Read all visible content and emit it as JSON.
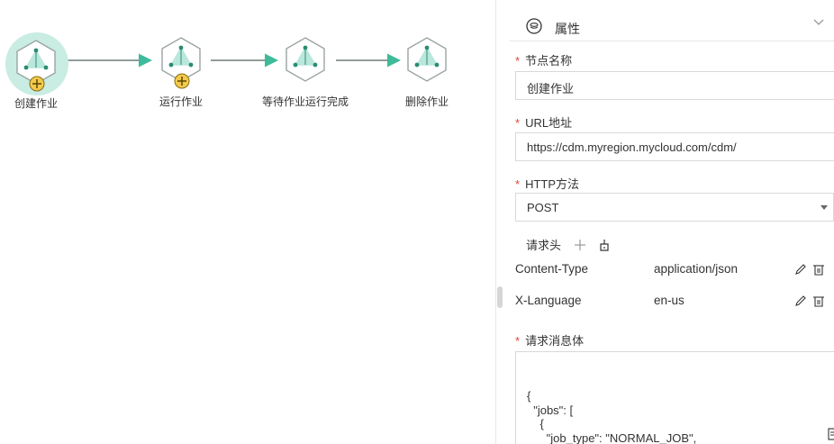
{
  "canvas": {
    "nodes": [
      {
        "label": "创建作业",
        "selected": true,
        "has_plus": true
      },
      {
        "label": "运行作业",
        "selected": false,
        "has_plus": true
      },
      {
        "label": "等待作业运行完成",
        "selected": false,
        "has_plus": false
      },
      {
        "label": "删除作业",
        "selected": false,
        "has_plus": false
      }
    ],
    "colors": {
      "accent": "#3dbb9a",
      "plus": "#f2c94c",
      "halo": "#c9ece3"
    }
  },
  "panel": {
    "title": "属性",
    "node_name": {
      "label": "节点名称",
      "value": "创建作业"
    },
    "url": {
      "label": "URL地址",
      "value": "https://cdm.myregion.mycloud.com/cdm/"
    },
    "method": {
      "label": "HTTP方法",
      "value": "POST"
    },
    "headers": {
      "label": "请求头",
      "rows": [
        {
          "key": "Content-Type",
          "value": "application/json"
        },
        {
          "key": "X-Language",
          "value": "en-us"
        }
      ]
    },
    "body": {
      "label": "请求消息体",
      "text": "{\n  \"jobs\": [\n    {\n      \"job_type\": \"NORMAL_JOB\",\n      \"to-config-values\": {"
    }
  }
}
